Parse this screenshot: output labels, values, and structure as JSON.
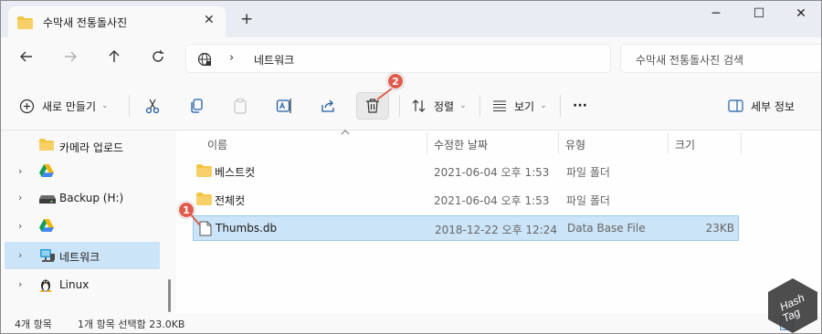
{
  "window": {
    "tab_title": "수막새 전통돌사진",
    "tab_close": "✕",
    "new_tab": "+",
    "minimize": "─",
    "maximize": "☐",
    "close": "✕"
  },
  "address": {
    "path": "네트워크",
    "separator": "›",
    "search_placeholder": "수막새 전통돌사진 검색"
  },
  "toolbar": {
    "new_label": "새로 만들기",
    "sort_label": "정렬",
    "view_label": "보기",
    "more_label": "···",
    "details_label": "세부 정보",
    "chevron": "⌄"
  },
  "sidebar": {
    "items": [
      {
        "label": "카메라 업로드",
        "icon": "folder-icon",
        "expander": ""
      },
      {
        "label": "",
        "icon": "google-drive-icon",
        "expander": "›"
      },
      {
        "label": "Backup (H:)",
        "icon": "drive-icon",
        "expander": "›"
      },
      {
        "label": "",
        "icon": "google-drive-icon",
        "expander": "›"
      },
      {
        "label": "네트워크",
        "icon": "network-icon",
        "expander": "›",
        "selected": true
      },
      {
        "label": "Linux",
        "icon": "linux-icon",
        "expander": "›"
      }
    ]
  },
  "columns": {
    "name": "이름",
    "date": "수정한 날짜",
    "type": "유형",
    "size": "크기"
  },
  "files": [
    {
      "name": "베스트컷",
      "date": "2021-06-04 오후 1:53",
      "type": "파일 폴더",
      "size": "",
      "icon": "folder-icon"
    },
    {
      "name": "전체컷",
      "date": "2021-06-04 오후 1:53",
      "type": "파일 폴더",
      "size": "",
      "icon": "folder-icon"
    },
    {
      "name": "Thumbs.db",
      "date": "2018-12-22 오후 12:24",
      "type": "Data Base File",
      "size": "23KB",
      "icon": "file-icon",
      "selected": true
    }
  ],
  "annotations": {
    "marker1": "1",
    "marker2": "2"
  },
  "status": {
    "count": "4개 항목",
    "selection": "1개 항목 선택함 23.0KB"
  },
  "watermark": {
    "text1": "Hash",
    "text2": "Tag"
  },
  "colors": {
    "accent": "#005fb8",
    "selection": "#cce4f7",
    "folder": "#f4c542",
    "badge": "#e05b4b"
  }
}
